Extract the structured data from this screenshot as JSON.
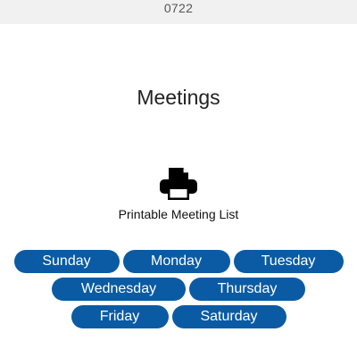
{
  "status_bar": {
    "time": "0722"
  },
  "page": {
    "title": "Meetings"
  },
  "print": {
    "label": "Printable Meeting List",
    "icon": "printer-icon"
  },
  "days": {
    "sunday": "Sunday",
    "monday": "Monday",
    "tuesday": "Tuesday",
    "wednesday": "Wednesday",
    "thursday": "Thursday",
    "friday": "Friday",
    "saturday": "Saturday"
  },
  "colors": {
    "button_bg": "#0a5ba3",
    "button_text": "#ffffff",
    "status_bg": "#f1f1f1"
  }
}
